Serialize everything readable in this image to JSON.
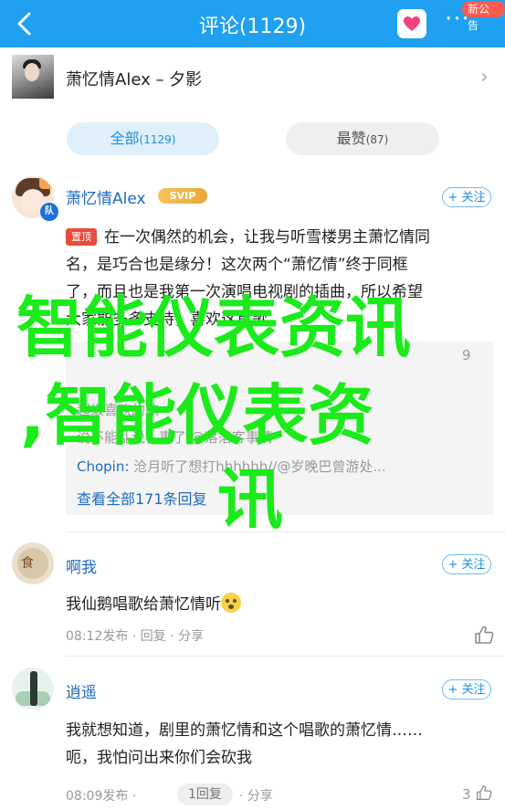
{
  "nav": {
    "title": "评论(1129)",
    "badge": "新公告",
    "more": "···"
  },
  "song": {
    "title": "萧忆情Alex – 夕影"
  },
  "tabs": {
    "all_label": "全部",
    "all_count": "(1129)",
    "hot_label": "最赞",
    "hot_count": "(87)"
  },
  "comments": [
    {
      "user": "萧忆情Alex",
      "vip": "SVIP",
      "avatar_badge": "队",
      "follow": "+ 关注",
      "pinned": "置顶",
      "lines": [
        "在一次偶然的机会，让我与听雪楼男主萧忆情同",
        "名，是巧合也是缘分！这次两个“萧忆情”终于同框",
        "了，而且也是我第一次演唱电视剧的插曲，所以希望",
        "大家能多多支持，喜欢这首歌。"
      ],
      "replies": [
        {
          "who": "",
          "text": "超级喜欢的歌"
        },
        {
          "who": "",
          "text": "说不能乱说，事了 @落落客事情"
        },
        {
          "who": "Chopin:",
          "text": " 沧月听了想打hhhhhh//@岁晚巴曾游处..."
        }
      ],
      "view_all": "查看全部171条回复",
      "like_count": "9"
    },
    {
      "user": "啊我",
      "follow": "+ 关注",
      "text": "我仙鹅唱歌给萧忆情听",
      "time": "08:12发布",
      "sep": "·",
      "reply_label": "回复",
      "share_label": "分享"
    },
    {
      "user": "逍遥",
      "follow": "+ 关注",
      "lines": [
        "我就想知道，剧里的萧忆情和这个唱歌的萧忆情……",
        "呃，我怕问出来你们会砍我"
      ],
      "time": "08:09发布",
      "sep": "·",
      "reply_label": "1回复",
      "share_label": "分享",
      "like_count": "3"
    }
  ],
  "watermark": {
    "line1": "智能仪表资讯",
    "line2": ",智能仪表资",
    "line3": "讯"
  },
  "colors": {
    "nav": "#1fa0f0",
    "link": "#1c6bc1",
    "watermark": "#1bea1b",
    "pinned": "#e94b3c"
  }
}
